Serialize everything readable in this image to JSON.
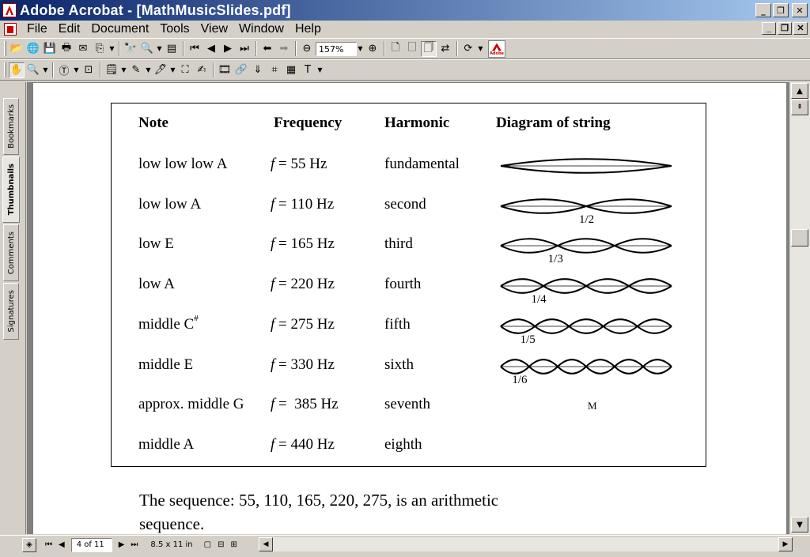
{
  "window": {
    "title": "Adobe Acrobat - [MathMusicSlides.pdf]"
  },
  "menu": [
    {
      "label": "File"
    },
    {
      "label": "Edit"
    },
    {
      "label": "Document"
    },
    {
      "label": "Tools"
    },
    {
      "label": "View"
    },
    {
      "label": "Window"
    },
    {
      "label": "Help"
    }
  ],
  "toolbar": {
    "zoom": "157%"
  },
  "navpane": {
    "tabs": [
      "Bookmarks",
      "Thumbnails",
      "Comments",
      "Signatures"
    ],
    "active": "Thumbnails"
  },
  "table": {
    "headers": [
      "Note",
      "Frequency",
      "Harmonic",
      "Diagram of string"
    ],
    "rows": [
      {
        "note": "low low low A",
        "freq_var": "f",
        "freq": " = 55 Hz",
        "harmonic": "fundamental",
        "fraction": "",
        "loops": 1
      },
      {
        "note": "low low A",
        "freq_var": "f",
        "freq": " = 110 Hz",
        "harmonic": "second",
        "fraction": "1/2",
        "loops": 2
      },
      {
        "note": "low E",
        "freq_var": "f",
        "freq": " = 165 Hz",
        "harmonic": "third",
        "fraction": "1/3",
        "loops": 3
      },
      {
        "note": "low A",
        "freq_var": "f",
        "freq": " = 220 Hz",
        "harmonic": "fourth",
        "fraction": "1/4",
        "loops": 4
      },
      {
        "note": "middle C",
        "note_sup": "#",
        "freq_var": "f",
        "freq": " = 275 Hz",
        "harmonic": "fifth",
        "fraction": "1/5",
        "loops": 5
      },
      {
        "note": "middle E",
        "freq_var": "f",
        "freq": " = 330 Hz",
        "harmonic": "sixth",
        "fraction": "1/6",
        "loops": 6
      },
      {
        "note": "approx. middle G",
        "freq_var": "f",
        "freq": " =  385 Hz",
        "harmonic": "seventh",
        "fraction": "",
        "loops": 0
      },
      {
        "note": "middle A",
        "freq_var": "f",
        "freq": " = 440 Hz",
        "harmonic": "eighth",
        "fraction": "",
        "loops": 0
      }
    ],
    "stray_mark": "M"
  },
  "paragraph": {
    "line1": "The sequence: 55, 110, 165, 220, 275,   is an arithmetic",
    "line2": "sequence."
  },
  "status": {
    "page": "4 of 11",
    "size": "8.5 x 11 in"
  }
}
